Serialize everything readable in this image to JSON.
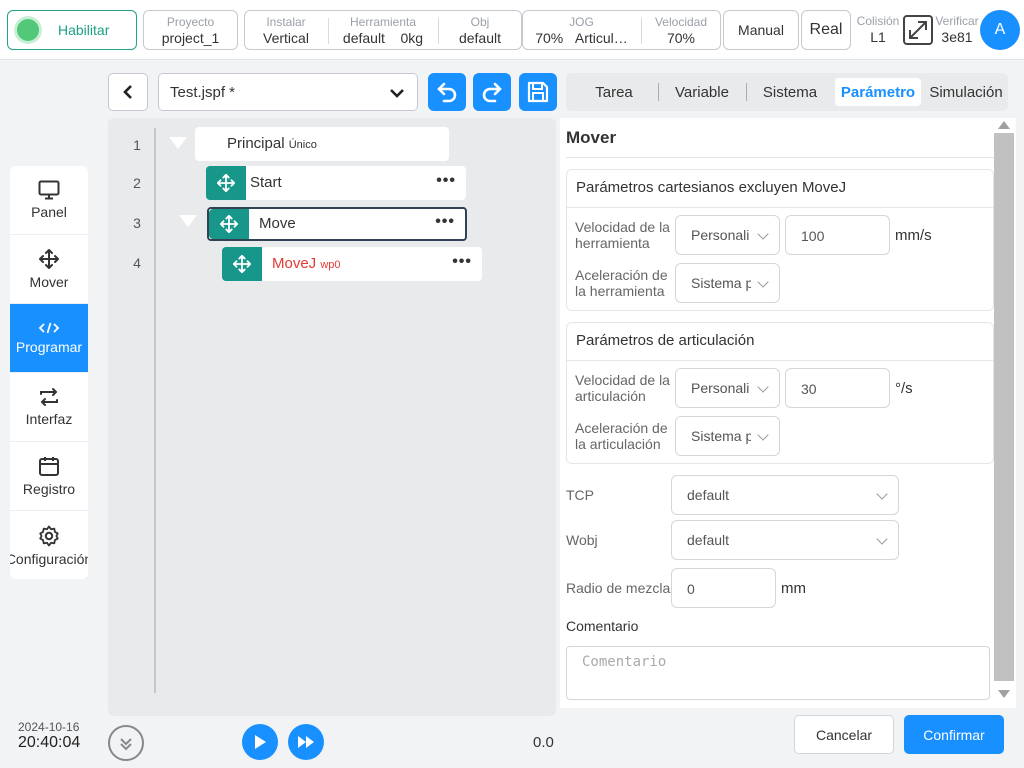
{
  "topbar": {
    "enable_label": "Habilitar",
    "project": {
      "label": "Proyecto",
      "value": "project_1"
    },
    "install": {
      "label": "Instalar",
      "value": "Vertical"
    },
    "tool": {
      "label": "Herramienta",
      "value": "default",
      "load": "0kg"
    },
    "obj": {
      "label": "Obj",
      "value": "default"
    },
    "jog": {
      "label": "JOG",
      "value1": "70%",
      "value2": "Articul…"
    },
    "speed": {
      "label": "Velocidad",
      "value": "70%"
    },
    "mode_manual": "Manual",
    "mode_real": "Real",
    "collision": {
      "label": "Colisión",
      "value": "L1"
    },
    "verify": {
      "label": "Verificar",
      "value": "3e81"
    },
    "avatar": "A"
  },
  "nav": {
    "items": [
      {
        "label": "Panel",
        "icon": "monitor-icon"
      },
      {
        "label": "Mover",
        "icon": "move-icon"
      },
      {
        "label": "Programar",
        "icon": "code-icon",
        "active": true
      },
      {
        "label": "Interfaz",
        "icon": "swap-icon"
      },
      {
        "label": "Registro",
        "icon": "calendar-icon"
      },
      {
        "label": "Configuración",
        "icon": "gear-icon"
      }
    ]
  },
  "clock": {
    "date": "2024-10-16",
    "time": "20:40:04"
  },
  "editor": {
    "filename": "Test.jspf *",
    "lines": [
      {
        "no": "1",
        "text": "Principal",
        "tag": "Único"
      },
      {
        "no": "2",
        "text": "Start"
      },
      {
        "no": "3",
        "text": "Move"
      },
      {
        "no": "4",
        "text": "MoveJ",
        "tag": "wp0"
      }
    ],
    "dots": "•••",
    "speed_value": "0.0"
  },
  "tabs": [
    {
      "label": "Tarea"
    },
    {
      "label": "Variable"
    },
    {
      "label": "Sistema"
    },
    {
      "label": "Parámetro",
      "active": true
    },
    {
      "label": "Simulación"
    }
  ],
  "params": {
    "title": "Mover",
    "cartesian": {
      "header": "Parámetros cartesianos excluyen MoveJ",
      "tool_speed_label_1": "Velocidad de la",
      "tool_speed_label_2": "herramienta",
      "tool_speed_mode": "Personali",
      "tool_speed_value": "100",
      "tool_speed_unit": "mm/s",
      "tool_acc_label_1": "Aceleración de",
      "tool_acc_label_2": "la herramienta",
      "tool_acc_mode": "Sistema p"
    },
    "joint": {
      "header": "Parámetros de articulación",
      "speed_label_1": "Velocidad de la",
      "speed_label_2": "articulación",
      "speed_mode": "Personali",
      "speed_value": "30",
      "speed_unit": "°/s",
      "acc_label_1": "Aceleración de",
      "acc_label_2": "la articulación",
      "acc_mode": "Sistema p"
    },
    "tcp_label": "TCP",
    "tcp_value": "default",
    "wobj_label": "Wobj",
    "wobj_value": "default",
    "blend_label": "Radio de mezcla",
    "blend_value": "0",
    "blend_unit": "mm",
    "comment_label": "Comentario",
    "comment_placeholder": "Comentario",
    "cancel": "Cancelar",
    "confirm": "Confirmar"
  },
  "colors": {
    "accent": "#1890ff",
    "teal": "#17968a",
    "enable_green": "#52c878",
    "moveJ_red": "#e53935"
  }
}
